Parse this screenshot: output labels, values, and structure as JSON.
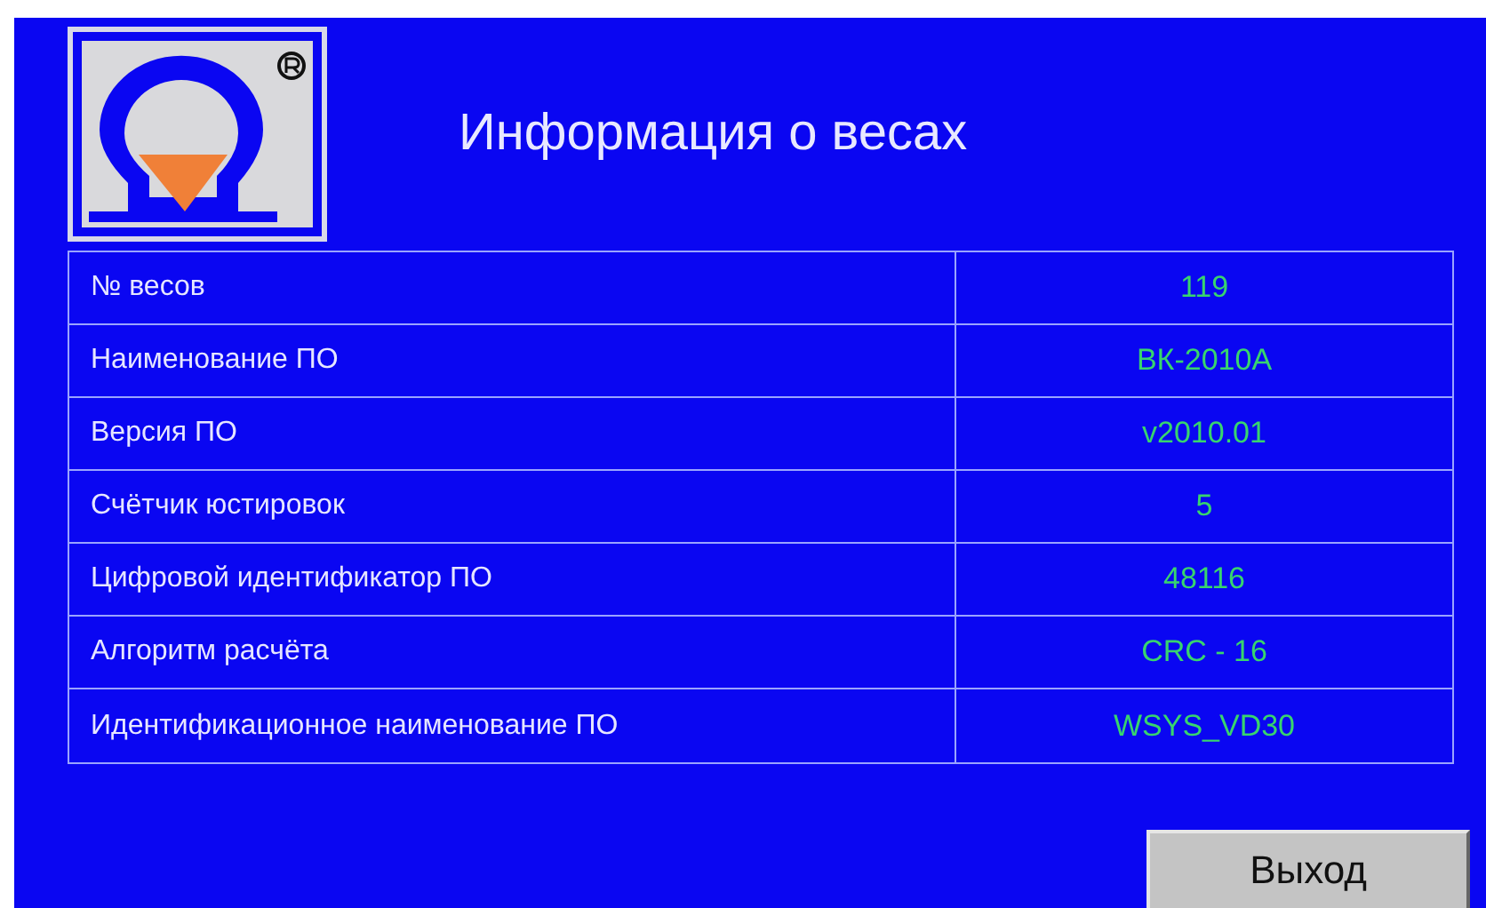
{
  "title": "Информация о весах",
  "rows": [
    {
      "label": "№ весов",
      "value": "119"
    },
    {
      "label": "Наименование ПО",
      "value": "ВК-2010А"
    },
    {
      "label": "Версия ПО",
      "value": "v2010.01"
    },
    {
      "label": "Счётчик юстировок",
      "value": "5"
    },
    {
      "label": "Цифровой идентификатор ПО",
      "value": "48116"
    },
    {
      "label": "Алгоритм расчёта",
      "value": "CRC - 16"
    },
    {
      "label": "Идентификационное наименование ПО",
      "value": "WSYS_VD30"
    }
  ],
  "exit_button": "Выход"
}
